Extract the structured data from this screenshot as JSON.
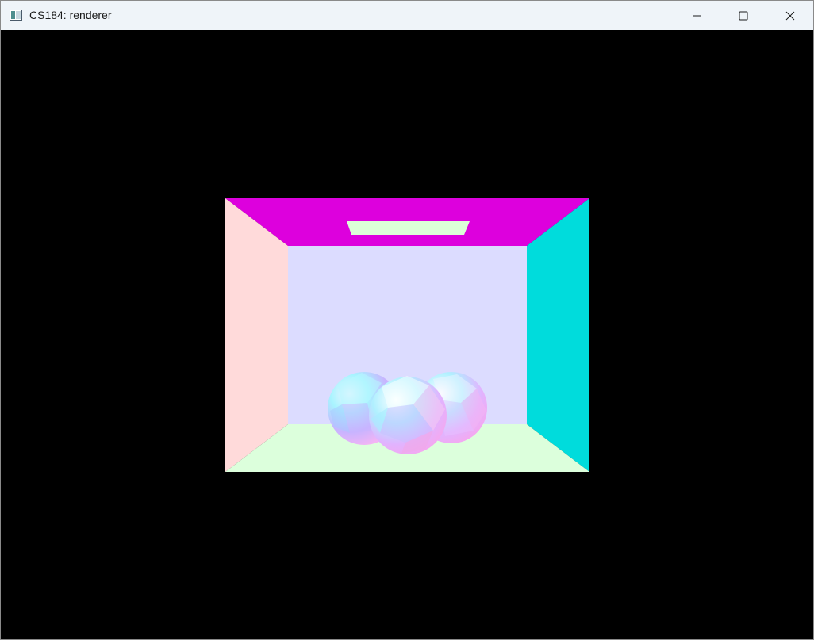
{
  "window": {
    "title": "CS184: renderer",
    "icon": "app-window-icon",
    "controls": {
      "minimize_icon": "minimize-icon",
      "maximize_icon": "maximize-icon",
      "close_icon": "close-icon"
    }
  },
  "render": {
    "background_color": "#000000",
    "colors": {
      "ceiling": "#dd00dd",
      "light": "#dcffd8",
      "left_wall": "#ffdada",
      "right_wall": "#00dcdc",
      "back_wall": "#dcdcff",
      "floor": "#dcffdc",
      "sphere_cyan": "#a8f4ff",
      "sphere_pink": "#f4b4f4",
      "sphere_violet": "#c8b4ff",
      "sphere_white": "#f4f4ff"
    }
  }
}
